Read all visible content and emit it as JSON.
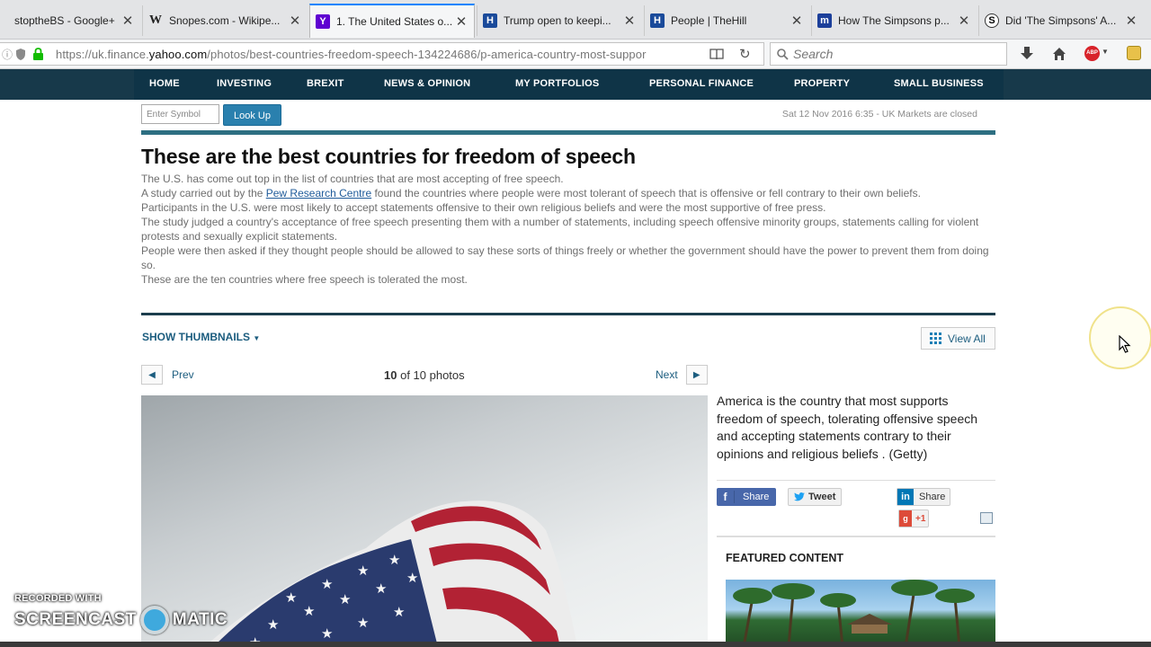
{
  "browser": {
    "tabs": [
      {
        "title": "stoptheBS - Google+",
        "favicon": "G+"
      },
      {
        "title": "Snopes.com - Wikipe...",
        "favicon": "W"
      },
      {
        "title": "1. The United States o...",
        "favicon": "Y"
      },
      {
        "title": "Trump open to keepi...",
        "favicon": "H"
      },
      {
        "title": "People | TheHill",
        "favicon": "H"
      },
      {
        "title": "How The Simpsons p...",
        "favicon": "m"
      },
      {
        "title": "Did 'The Simpsons' A...",
        "favicon": "S"
      }
    ],
    "url_prefix": "https://uk.finance.",
    "url_domain": "yahoo.com",
    "url_path": "/photos/best-countries-freedom-speech-134224686/p-america-country-most-suppor",
    "search_placeholder": "Search"
  },
  "site_nav": [
    "HOME",
    "INVESTING",
    "BREXIT",
    "NEWS & OPINION",
    "MY PORTFOLIOS",
    "PERSONAL FINANCE",
    "PROPERTY",
    "SMALL BUSINESS"
  ],
  "symbol_lookup": {
    "placeholder": "Enter Symbol",
    "button": "Look Up",
    "market_status": "Sat 12 Nov 2016 6:35 - UK Markets are closed"
  },
  "article": {
    "headline": "These are the best countries for freedom of speech",
    "para1": "The U.S. has come out top in the list of countries that are most accepting of free speech.",
    "para2_before": "A study carried out by the ",
    "para2_link": "Pew Research Centre",
    "para2_after": " found the countries where people were most tolerant of speech that is offensive or fell contrary to their own beliefs.",
    "para3": "Participants in the U.S. were most likely to accept statements offensive to their own religious beliefs and were the most supportive of free press.",
    "para4": "The study judged a country's acceptance of free speech presenting them with a number of statements, including speech offensive minority groups, statements calling for violent protests and sexually explicit statements.",
    "para5": "People were then asked if they thought people should be allowed to say these sorts of things freely or whether the government should have the power to prevent them from doing so.",
    "para6": "These are the ten countries where free speech is tolerated the most."
  },
  "gallery": {
    "show_thumbnails": "SHOW THUMBNAILS",
    "view_all": "View All",
    "prev": "Prev",
    "next": "Next",
    "current": "10",
    "of_label": "of 10 photos",
    "caption": "America is the country that most supports freedom of speech, tolerating offensive speech and accepting statements contrary to their opinions and religious beliefs . (Getty)"
  },
  "share": {
    "facebook": "Share",
    "twitter": "Tweet",
    "linkedin": "Share",
    "gplus": "+1"
  },
  "featured_heading": "FEATURED CONTENT",
  "watermark": {
    "line1": "RECORDED WITH",
    "left": "SCREENCAST",
    "right": "MATIC"
  },
  "colors": {
    "nav_bg": "#0f3447",
    "accent_teal": "#2e6f82",
    "button_blue": "#2a80ae",
    "facebook": "#4867aa"
  }
}
